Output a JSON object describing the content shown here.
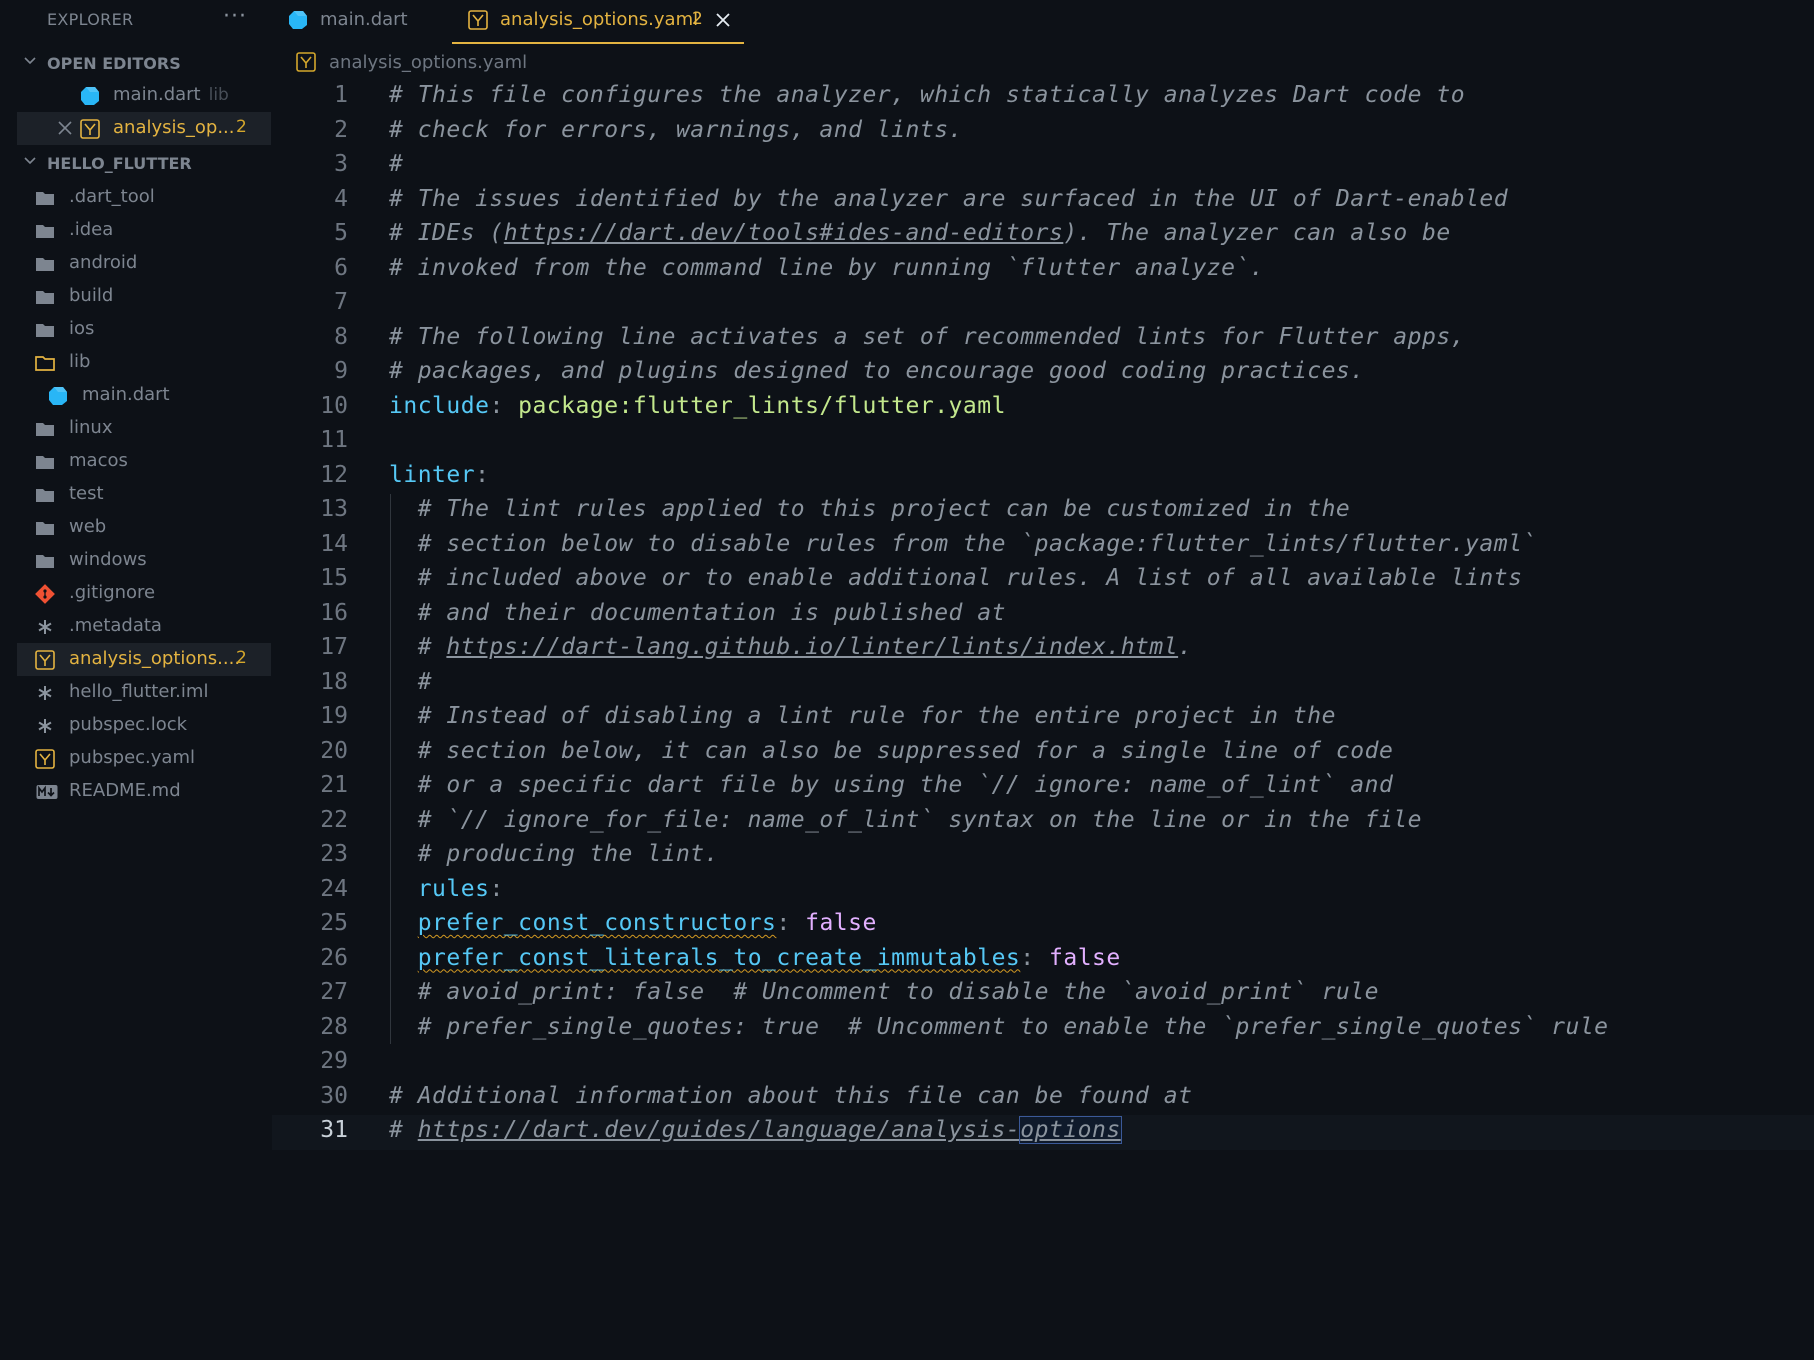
{
  "explorer": {
    "title": "EXPLORER",
    "more": "···",
    "open_editors": {
      "label": "OPEN EDITORS",
      "items": [
        {
          "name": "main.dart",
          "description": "lib"
        },
        {
          "name": "analysis_op...",
          "count": "2"
        }
      ]
    },
    "project": {
      "label": "HELLO_FLUTTER",
      "items": [
        {
          "name": ".dart_tool",
          "icon": "folder-icon"
        },
        {
          "name": ".idea",
          "icon": "folder-icon"
        },
        {
          "name": "android",
          "icon": "folder-icon"
        },
        {
          "name": "build",
          "icon": "folder-icon"
        },
        {
          "name": "ios",
          "icon": "folder-icon"
        },
        {
          "name": "lib",
          "icon": "folder-open-icon"
        },
        {
          "name": "main.dart",
          "icon": "dart-icon"
        },
        {
          "name": "linux",
          "icon": "folder-icon"
        },
        {
          "name": "macos",
          "icon": "folder-icon"
        },
        {
          "name": "test",
          "icon": "folder-icon"
        },
        {
          "name": "web",
          "icon": "folder-icon"
        },
        {
          "name": "windows",
          "icon": "folder-icon"
        },
        {
          "name": ".gitignore",
          "icon": "git-icon"
        },
        {
          "name": ".metadata",
          "icon": "asterisk-icon"
        },
        {
          "name": "analysis_options....",
          "icon": "yaml-icon",
          "count": "2"
        },
        {
          "name": "hello_flutter.iml",
          "icon": "asterisk-icon"
        },
        {
          "name": "pubspec.lock",
          "icon": "asterisk-icon"
        },
        {
          "name": "pubspec.yaml",
          "icon": "yaml-icon"
        },
        {
          "name": "README.md",
          "icon": "markdown-icon"
        }
      ]
    }
  },
  "tabs": [
    {
      "name": "main.dart"
    },
    {
      "name": "analysis_options.yaml",
      "count": "2"
    }
  ],
  "breadcrumb": {
    "file": "analysis_options.yaml"
  },
  "editor": {
    "line_numbers": [
      "1",
      "2",
      "3",
      "4",
      "5",
      "6",
      "7",
      "8",
      "9",
      "10",
      "11",
      "12",
      "13",
      "14",
      "15",
      "16",
      "17",
      "18",
      "19",
      "20",
      "21",
      "22",
      "23",
      "24",
      "25",
      "26",
      "27",
      "28",
      "29",
      "30",
      "31"
    ],
    "lines": {
      "l1": "# This file configures the analyzer, which statically analyzes Dart code to",
      "l2": "# check for errors, warnings, and lints.",
      "l3": "#",
      "l4": "# The issues identified by the analyzer are surfaced in the UI of Dart-enabled",
      "l5a": "# IDEs (",
      "l5url": "https://dart.dev/tools#ides-and-editors",
      "l5b": "). The analyzer can also be",
      "l6": "# invoked from the command line by running `flutter analyze`.",
      "l7": "",
      "l8": "# The following line activates a set of recommended lints for Flutter apps,",
      "l9": "# packages, and plugins designed to encourage good coding practices.",
      "l10key": "include",
      "l10colon": ": ",
      "l10val": "package:flutter_lints/flutter.yaml",
      "l11": "",
      "l12key": "linter",
      "l12colon": ":",
      "l13": "  # The lint rules applied to this project can be customized in the",
      "l14": "  # section below to disable rules from the `package:flutter_lints/flutter.yaml`",
      "l15": "  # included above or to enable additional rules. A list of all available lints",
      "l16": "  # and their documentation is published at",
      "l17a": "  # ",
      "l17url": "https://dart-lang.github.io/linter/lints/index.html",
      "l17b": ".",
      "l18": "  #",
      "l19": "  # Instead of disabling a lint rule for the entire project in the",
      "l20": "  # section below, it can also be suppressed for a single line of code",
      "l21": "  # or a specific dart file by using the `// ignore: name_of_lint` and",
      "l22": "  # `// ignore_for_file: name_of_lint` syntax on the line or in the file",
      "l23": "  # producing the lint.",
      "l24indent": "  ",
      "l24key": "rules",
      "l24colon": ":",
      "l25indent": "  ",
      "l25key": "prefer_const_constructors",
      "l25colon": ": ",
      "l25val": "false",
      "l26indent": "  ",
      "l26key": "prefer_const_literals_to_create_immutables",
      "l26colon": ": ",
      "l26val": "false",
      "l27": "  # avoid_print: false  # Uncomment to disable the `avoid_print` rule",
      "l28": "  # prefer_single_quotes: true  # Uncomment to enable the `prefer_single_quotes` rule",
      "l29": "",
      "l30": "# Additional information about this file can be found at",
      "l31a": "# ",
      "l31url": "https://dart.dev/guides/language/analysis-",
      "l31sel": "options"
    }
  }
}
